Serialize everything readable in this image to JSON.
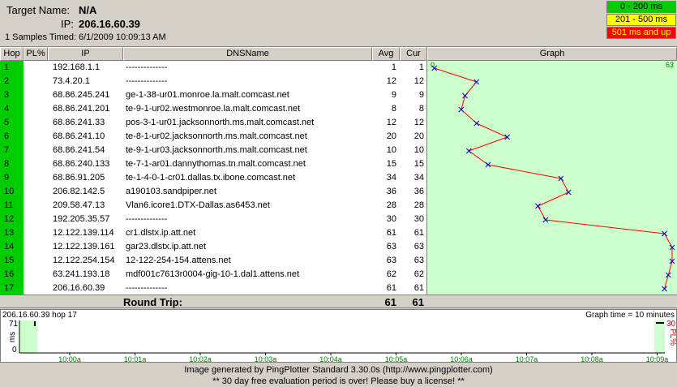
{
  "header": {
    "target_label": "Target Name:",
    "target_value": "N/A",
    "ip_label": "IP:",
    "ip_value": "206.16.60.39",
    "samples_label": "1 Samples Timed:",
    "samples_value": "6/1/2009 10:09:13 AM"
  },
  "legend": [
    {
      "label": "0 - 200 ms",
      "color": "#00cc00"
    },
    {
      "label": "201 - 500 ms",
      "color": "#ffff00"
    },
    {
      "label": "501 ms and up",
      "color": "#ff0000"
    }
  ],
  "columns": [
    "Hop",
    "PL%",
    "IP",
    "DNSName",
    "Avg",
    "Cur",
    "Graph"
  ],
  "graph_scale": {
    "min_label": "0",
    "max_label": "63",
    "max": 63
  },
  "hops": [
    {
      "hop": "1",
      "pl": "",
      "ip": "192.168.1.1",
      "dns": "--------------",
      "avg": "1",
      "cur": "1"
    },
    {
      "hop": "2",
      "pl": "",
      "ip": "73.4.20.1",
      "dns": "--------------",
      "avg": "12",
      "cur": "12"
    },
    {
      "hop": "3",
      "pl": "",
      "ip": "68.86.245.241",
      "dns": "ge-1-38-ur01.monroe.la.malt.comcast.net",
      "avg": "9",
      "cur": "9"
    },
    {
      "hop": "4",
      "pl": "",
      "ip": "68.86.241.201",
      "dns": "te-9-1-ur02.westmonroe.la.malt.comcast.net",
      "avg": "8",
      "cur": "8"
    },
    {
      "hop": "5",
      "pl": "",
      "ip": "68.86.241.33",
      "dns": "pos-3-1-ur01.jacksonnorth.ms.malt.comcast.net",
      "avg": "12",
      "cur": "12"
    },
    {
      "hop": "6",
      "pl": "",
      "ip": "68.86.241.10",
      "dns": "te-8-1-ur02.jacksonnorth.ms.malt.comcast.net",
      "avg": "20",
      "cur": "20"
    },
    {
      "hop": "7",
      "pl": "",
      "ip": "68.86.241.54",
      "dns": "te-9-1-ur03.jacksonnorth.ms.malt.comcast.net",
      "avg": "10",
      "cur": "10"
    },
    {
      "hop": "8",
      "pl": "",
      "ip": "68.86.240.133",
      "dns": "te-7-1-ar01.dannythomas.tn.malt.comcast.net",
      "avg": "15",
      "cur": "15"
    },
    {
      "hop": "9",
      "pl": "",
      "ip": "68.86.91.205",
      "dns": "te-1-4-0-1-cr01.dallas.tx.ibone.comcast.net",
      "avg": "34",
      "cur": "34"
    },
    {
      "hop": "10",
      "pl": "",
      "ip": "206.82.142.5",
      "dns": "a190103.sandpiper.net",
      "avg": "36",
      "cur": "36"
    },
    {
      "hop": "11",
      "pl": "",
      "ip": "209.58.47.13",
      "dns": "Vlan6.icore1.DTX-Dallas.as6453.net",
      "avg": "28",
      "cur": "28"
    },
    {
      "hop": "12",
      "pl": "",
      "ip": "192.205.35.57",
      "dns": "--------------",
      "avg": "30",
      "cur": "30"
    },
    {
      "hop": "13",
      "pl": "",
      "ip": "12.122.139.114",
      "dns": "cr1.dlstx.ip.att.net",
      "avg": "61",
      "cur": "61"
    },
    {
      "hop": "14",
      "pl": "",
      "ip": "12.122.139.161",
      "dns": "gar23.dlstx.ip.att.net",
      "avg": "63",
      "cur": "63"
    },
    {
      "hop": "15",
      "pl": "",
      "ip": "12.122.254.154",
      "dns": "12-122-254-154.attens.net",
      "avg": "63",
      "cur": "63"
    },
    {
      "hop": "16",
      "pl": "",
      "ip": "63.241.193.18",
      "dns": "mdf001c7613r0004-gig-10-1.dal1.attens.net",
      "avg": "62",
      "cur": "62"
    },
    {
      "hop": "17",
      "pl": "",
      "ip": "206.16.60.39",
      "dns": "--------------",
      "avg": "61",
      "cur": "61"
    }
  ],
  "round_trip": {
    "label": "Round Trip:",
    "avg": "61",
    "cur": "61"
  },
  "timeline": {
    "title": "206.16.60.39 hop 17",
    "graph_time": "Graph time = 10 minutes",
    "y_max": "71",
    "y_unit": "ms",
    "y_zero": "0",
    "pl_max": "30",
    "pl_unit": "PL%",
    "ticks": [
      "10:00a",
      "10:01a",
      "10:02a",
      "10:03a",
      "10:04a",
      "10:05a",
      "10:06a",
      "10:07a",
      "10:08a",
      "10:09a"
    ]
  },
  "footer": {
    "line1": "Image generated by PingPlotter Standard 3.30.0s (http://www.pingplotter.com)",
    "line2": "** 30 day free evaluation period is over!  Please buy a license! **"
  }
}
